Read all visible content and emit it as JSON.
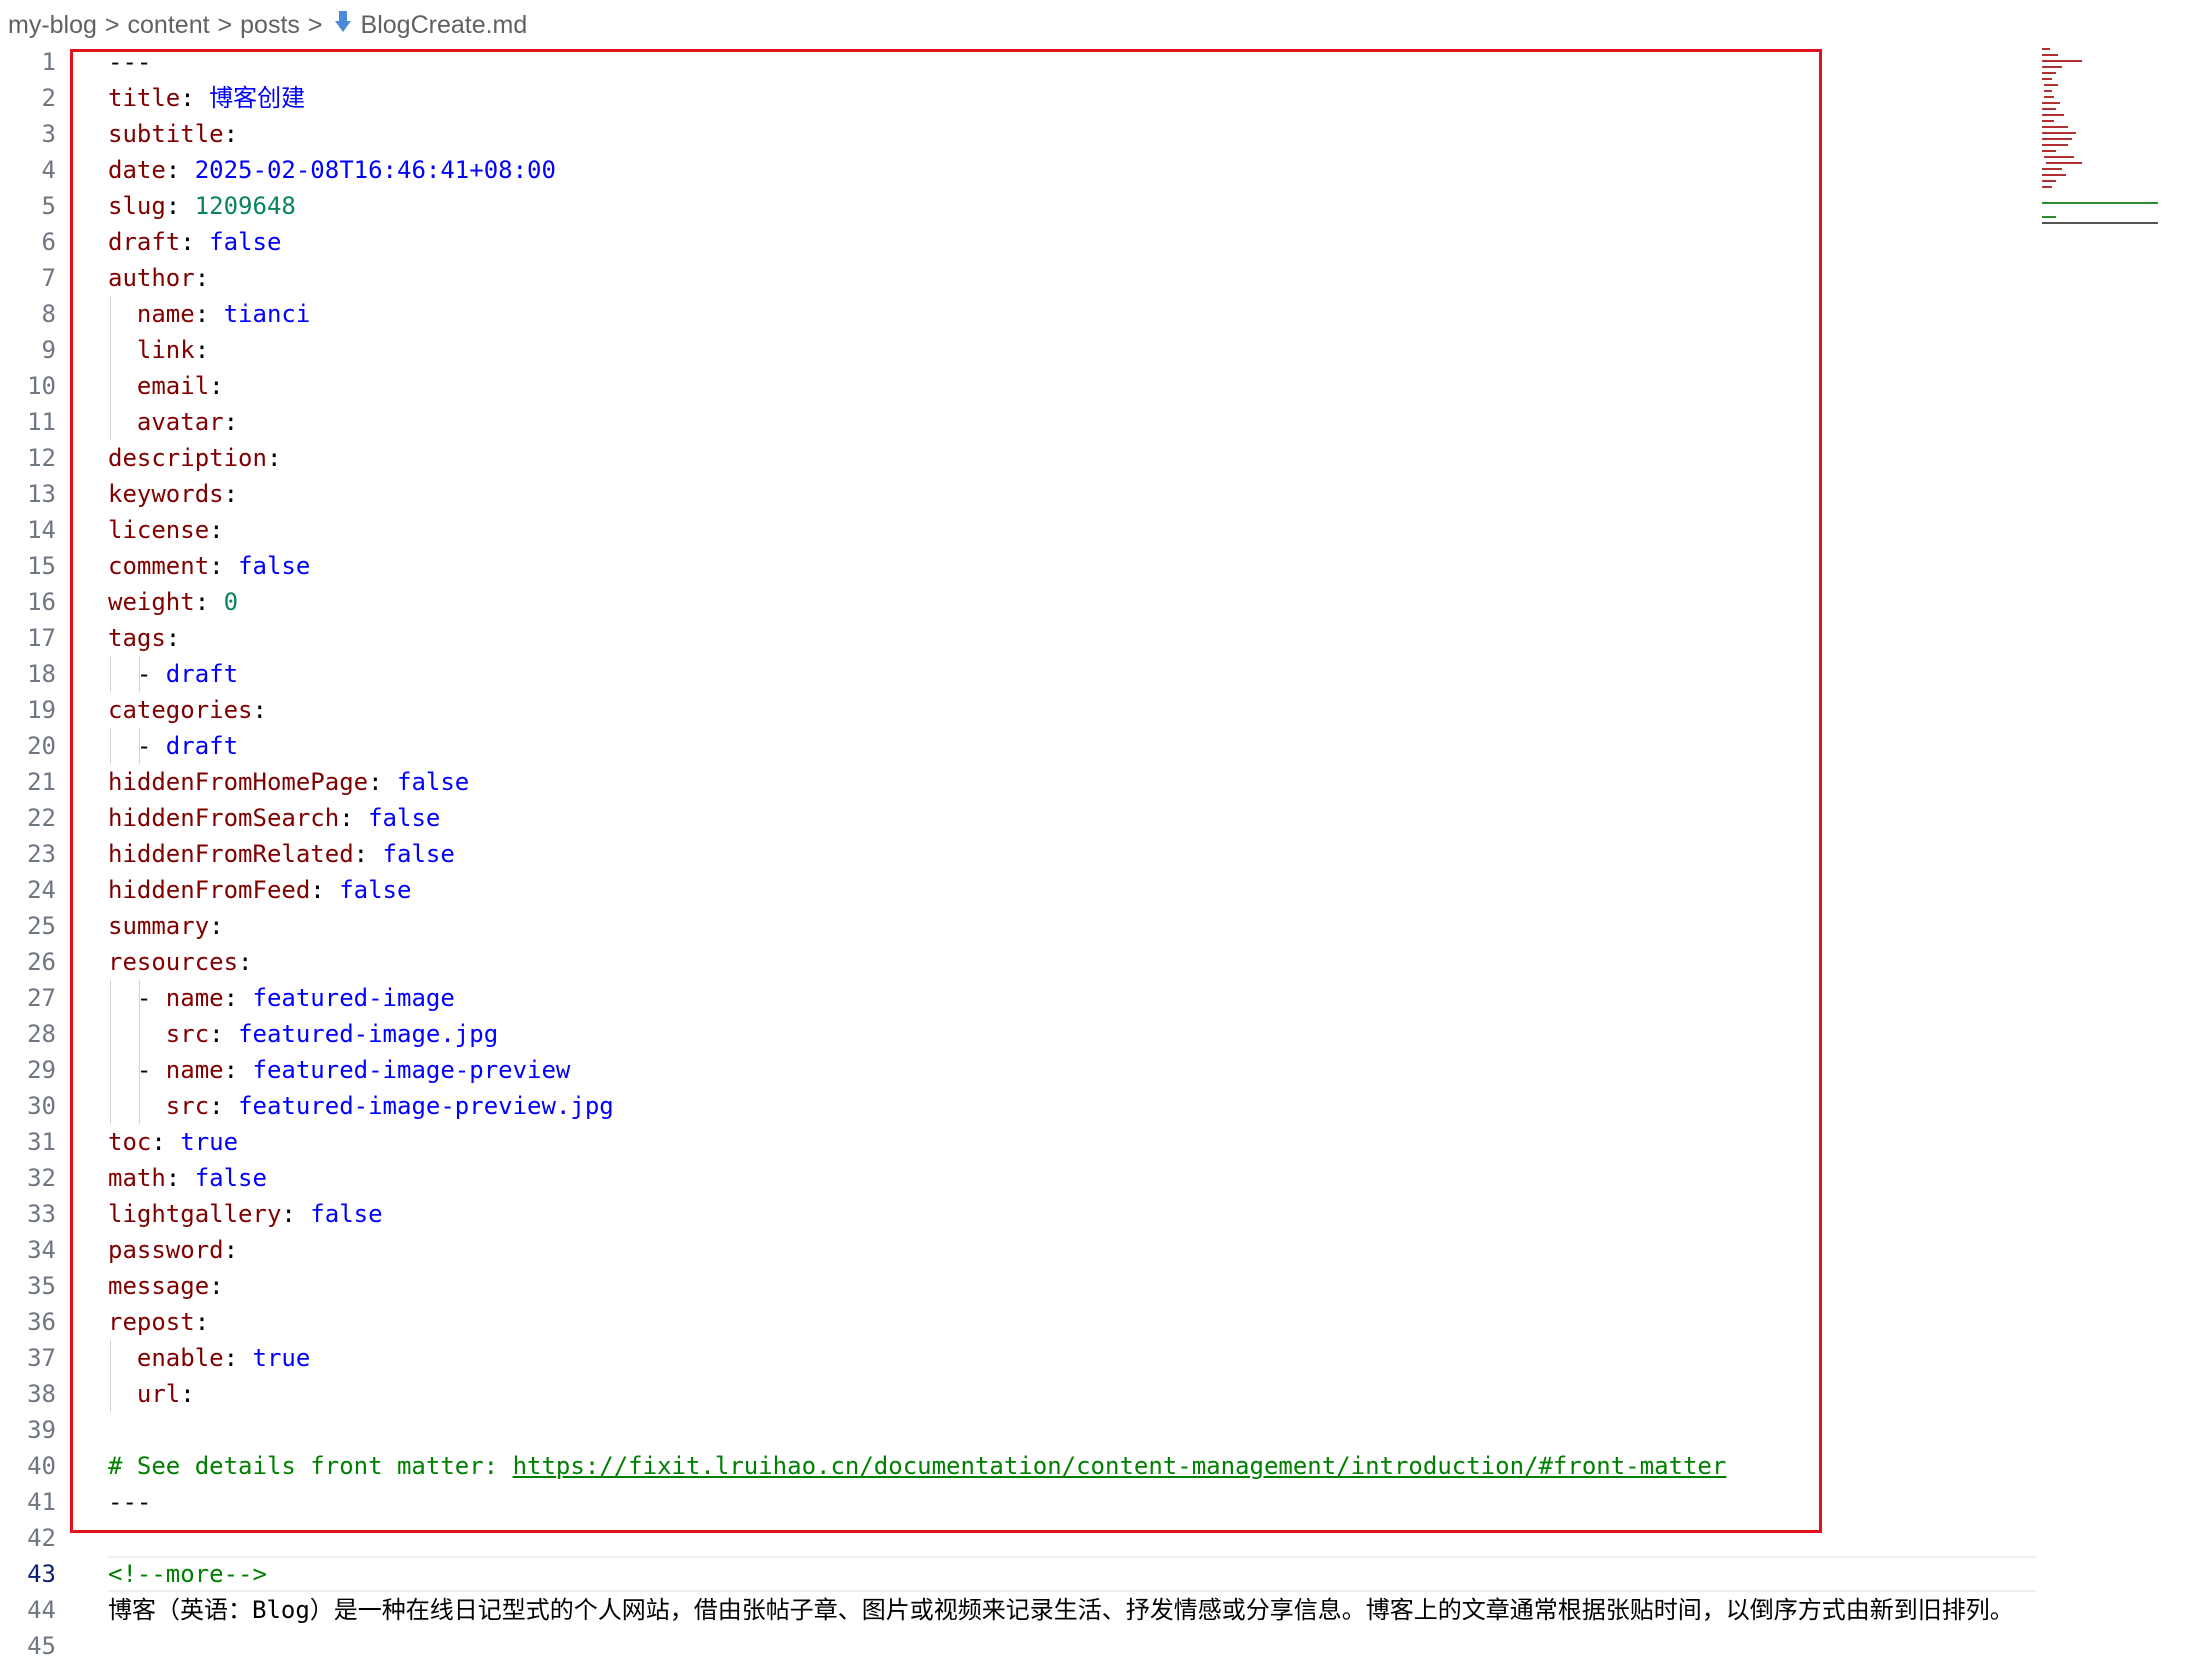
{
  "breadcrumb": {
    "parts": [
      "my-blog",
      "content",
      "posts"
    ],
    "file": "BlogCreate.md",
    "separator": ">"
  },
  "editor": {
    "active_line": 43,
    "lines": [
      {
        "n": "1",
        "t": [
          [
            "p",
            "---"
          ]
        ]
      },
      {
        "n": "2",
        "t": [
          [
            "k",
            "title"
          ],
          [
            "p",
            ": "
          ],
          [
            "s",
            "博客创建"
          ]
        ]
      },
      {
        "n": "3",
        "t": [
          [
            "k",
            "subtitle"
          ],
          [
            "p",
            ":"
          ]
        ]
      },
      {
        "n": "4",
        "t": [
          [
            "k",
            "date"
          ],
          [
            "p",
            ": "
          ],
          [
            "s",
            "2025-02-08T16:46:41+08:00"
          ]
        ]
      },
      {
        "n": "5",
        "t": [
          [
            "k",
            "slug"
          ],
          [
            "p",
            ": "
          ],
          [
            "n",
            "1209648"
          ]
        ]
      },
      {
        "n": "6",
        "t": [
          [
            "k",
            "draft"
          ],
          [
            "p",
            ": "
          ],
          [
            "s",
            "false"
          ]
        ]
      },
      {
        "n": "7",
        "t": [
          [
            "k",
            "author"
          ],
          [
            "p",
            ":"
          ]
        ]
      },
      {
        "n": "8",
        "t": [
          [
            "p",
            "  "
          ],
          [
            "k",
            "name"
          ],
          [
            "p",
            ": "
          ],
          [
            "s",
            "tianci"
          ]
        ]
      },
      {
        "n": "9",
        "t": [
          [
            "p",
            "  "
          ],
          [
            "k",
            "link"
          ],
          [
            "p",
            ":"
          ]
        ]
      },
      {
        "n": "10",
        "t": [
          [
            "p",
            "  "
          ],
          [
            "k",
            "email"
          ],
          [
            "p",
            ":"
          ]
        ]
      },
      {
        "n": "11",
        "t": [
          [
            "p",
            "  "
          ],
          [
            "k",
            "avatar"
          ],
          [
            "p",
            ":"
          ]
        ]
      },
      {
        "n": "12",
        "t": [
          [
            "k",
            "description"
          ],
          [
            "p",
            ":"
          ]
        ]
      },
      {
        "n": "13",
        "t": [
          [
            "k",
            "keywords"
          ],
          [
            "p",
            ":"
          ]
        ]
      },
      {
        "n": "14",
        "t": [
          [
            "k",
            "license"
          ],
          [
            "p",
            ":"
          ]
        ]
      },
      {
        "n": "15",
        "t": [
          [
            "k",
            "comment"
          ],
          [
            "p",
            ": "
          ],
          [
            "s",
            "false"
          ]
        ]
      },
      {
        "n": "16",
        "t": [
          [
            "k",
            "weight"
          ],
          [
            "p",
            ": "
          ],
          [
            "n",
            "0"
          ]
        ]
      },
      {
        "n": "17",
        "t": [
          [
            "k",
            "tags"
          ],
          [
            "p",
            ":"
          ]
        ]
      },
      {
        "n": "18",
        "t": [
          [
            "p",
            "  - "
          ],
          [
            "s",
            "draft"
          ]
        ]
      },
      {
        "n": "19",
        "t": [
          [
            "k",
            "categories"
          ],
          [
            "p",
            ":"
          ]
        ]
      },
      {
        "n": "20",
        "t": [
          [
            "p",
            "  - "
          ],
          [
            "s",
            "draft"
          ]
        ]
      },
      {
        "n": "21",
        "t": [
          [
            "k",
            "hiddenFromHomePage"
          ],
          [
            "p",
            ": "
          ],
          [
            "s",
            "false"
          ]
        ]
      },
      {
        "n": "22",
        "t": [
          [
            "k",
            "hiddenFromSearch"
          ],
          [
            "p",
            ": "
          ],
          [
            "s",
            "false"
          ]
        ]
      },
      {
        "n": "23",
        "t": [
          [
            "k",
            "hiddenFromRelated"
          ],
          [
            "p",
            ": "
          ],
          [
            "s",
            "false"
          ]
        ]
      },
      {
        "n": "24",
        "t": [
          [
            "k",
            "hiddenFromFeed"
          ],
          [
            "p",
            ": "
          ],
          [
            "s",
            "false"
          ]
        ]
      },
      {
        "n": "25",
        "t": [
          [
            "k",
            "summary"
          ],
          [
            "p",
            ":"
          ]
        ]
      },
      {
        "n": "26",
        "t": [
          [
            "k",
            "resources"
          ],
          [
            "p",
            ":"
          ]
        ]
      },
      {
        "n": "27",
        "t": [
          [
            "p",
            "  - "
          ],
          [
            "k",
            "name"
          ],
          [
            "p",
            ": "
          ],
          [
            "s",
            "featured-image"
          ]
        ]
      },
      {
        "n": "28",
        "t": [
          [
            "p",
            "    "
          ],
          [
            "k",
            "src"
          ],
          [
            "p",
            ": "
          ],
          [
            "s",
            "featured-image.jpg"
          ]
        ]
      },
      {
        "n": "29",
        "t": [
          [
            "p",
            "  - "
          ],
          [
            "k",
            "name"
          ],
          [
            "p",
            ": "
          ],
          [
            "s",
            "featured-image-preview"
          ]
        ]
      },
      {
        "n": "30",
        "t": [
          [
            "p",
            "    "
          ],
          [
            "k",
            "src"
          ],
          [
            "p",
            ": "
          ],
          [
            "s",
            "featured-image-preview.jpg"
          ]
        ]
      },
      {
        "n": "31",
        "t": [
          [
            "k",
            "toc"
          ],
          [
            "p",
            ": "
          ],
          [
            "s",
            "true"
          ]
        ]
      },
      {
        "n": "32",
        "t": [
          [
            "k",
            "math"
          ],
          [
            "p",
            ": "
          ],
          [
            "s",
            "false"
          ]
        ]
      },
      {
        "n": "33",
        "t": [
          [
            "k",
            "lightgallery"
          ],
          [
            "p",
            ": "
          ],
          [
            "s",
            "false"
          ]
        ]
      },
      {
        "n": "34",
        "t": [
          [
            "k",
            "password"
          ],
          [
            "p",
            ":"
          ]
        ]
      },
      {
        "n": "35",
        "t": [
          [
            "k",
            "message"
          ],
          [
            "p",
            ":"
          ]
        ]
      },
      {
        "n": "36",
        "t": [
          [
            "k",
            "repost"
          ],
          [
            "p",
            ":"
          ]
        ]
      },
      {
        "n": "37",
        "t": [
          [
            "p",
            "  "
          ],
          [
            "k",
            "enable"
          ],
          [
            "p",
            ": "
          ],
          [
            "s",
            "true"
          ]
        ]
      },
      {
        "n": "38",
        "t": [
          [
            "p",
            "  "
          ],
          [
            "k",
            "url"
          ],
          [
            "p",
            ":"
          ]
        ]
      },
      {
        "n": "39",
        "t": []
      },
      {
        "n": "40",
        "t": [
          [
            "c",
            "# See details front matter: "
          ],
          [
            "l",
            "https://fixit.lruihao.cn/documentation/content-management/introduction/#front-matter"
          ]
        ]
      },
      {
        "n": "41",
        "t": [
          [
            "p",
            "---"
          ]
        ]
      },
      {
        "n": "42",
        "t": []
      },
      {
        "n": "43",
        "t": [
          [
            "c",
            "<!--more-->"
          ]
        ]
      },
      {
        "n": "44",
        "t": [
          [
            "p",
            "博客（英语：Blog）是一种在线日记型式的个人网站，借由张帖子章、图片或视频来记录生活、抒发情感或分享信息。博客上的文章通常根据张贴时间，以倒序方式由新到旧排列。"
          ]
        ]
      },
      {
        "n": "45",
        "t": []
      }
    ]
  },
  "colors": {
    "key": "#800000",
    "string": "#0000ff",
    "number": "#098658",
    "comment": "#008000",
    "highlight_frame": "#e3121a"
  }
}
